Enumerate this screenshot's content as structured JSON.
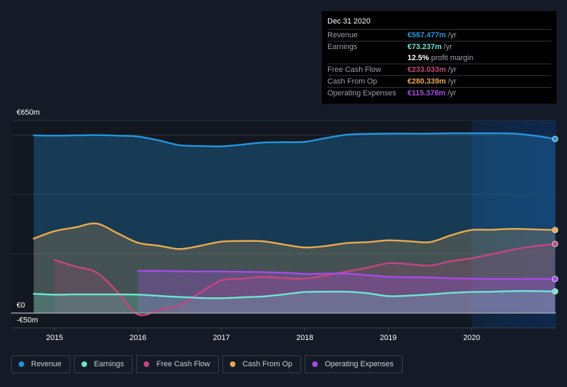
{
  "tooltip": {
    "date": "Dec 31 2020",
    "rows": [
      {
        "label": "Revenue",
        "value": "€587.477m",
        "unit": "/yr",
        "color": "#2394df"
      },
      {
        "label": "Earnings",
        "value": "€73.237m",
        "unit": "/yr",
        "color": "#6ce5d0"
      },
      {
        "label": "",
        "value": "12.5%",
        "unit": "profit margin",
        "color": "#ffffff"
      },
      {
        "label": "Free Cash Flow",
        "value": "€233.033m",
        "unit": "/yr",
        "color": "#c4467f"
      },
      {
        "label": "Cash From Op",
        "value": "€280.339m",
        "unit": "/yr",
        "color": "#e8a94e"
      },
      {
        "label": "Operating Expenses",
        "value": "€115.378m",
        "unit": "/yr",
        "color": "#a64ae8"
      }
    ]
  },
  "legend": [
    {
      "label": "Revenue",
      "color": "#2394df"
    },
    {
      "label": "Earnings",
      "color": "#6ce5d0"
    },
    {
      "label": "Free Cash Flow",
      "color": "#c4467f"
    },
    {
      "label": "Cash From Op",
      "color": "#e8a94e"
    },
    {
      "label": "Operating Expenses",
      "color": "#a64ae8"
    }
  ],
  "chart_data": {
    "type": "area",
    "title": "",
    "xlabel": "",
    "ylabel": "",
    "currency": "€",
    "y_unit": "m",
    "ylim": [
      -50,
      650
    ],
    "y_tick_labels": [
      {
        "value": 650,
        "label": "€650m"
      },
      {
        "value": 0,
        "label": "€0"
      },
      {
        "value": -50,
        "label": "-€50m"
      }
    ],
    "gridlines": [
      650,
      600,
      400,
      200,
      0,
      -50
    ],
    "xlim": [
      2014.5,
      2021.0
    ],
    "x_ticks": [
      2015,
      2016,
      2017,
      2018,
      2019,
      2020
    ],
    "highlight_from": 2020.0,
    "legend_position": "bottom-left",
    "series": [
      {
        "name": "Revenue",
        "color": "#2394df",
        "x": [
          2014.75,
          2015.0,
          2015.25,
          2015.5,
          2015.75,
          2016.0,
          2016.25,
          2016.5,
          2016.75,
          2017.0,
          2017.25,
          2017.5,
          2017.75,
          2018.0,
          2018.25,
          2018.5,
          2018.75,
          2019.0,
          2019.25,
          2019.5,
          2019.75,
          2020.0,
          2020.25,
          2020.5,
          2020.75,
          2021.0
        ],
        "values": [
          599,
          598,
          599,
          600,
          598,
          595,
          582,
          566,
          563,
          562,
          568,
          575,
          576,
          577,
          590,
          601,
          604,
          605,
          605,
          605,
          606,
          606,
          606,
          605,
          598,
          587
        ]
      },
      {
        "name": "Cash From Op",
        "color": "#e8a94e",
        "x": [
          2014.75,
          2015.0,
          2015.25,
          2015.5,
          2015.75,
          2016.0,
          2016.25,
          2016.5,
          2016.75,
          2017.0,
          2017.25,
          2017.5,
          2017.75,
          2018.0,
          2018.25,
          2018.5,
          2018.75,
          2019.0,
          2019.25,
          2019.5,
          2019.75,
          2020.0,
          2020.25,
          2020.5,
          2020.75,
          2021.0
        ],
        "values": [
          251,
          276,
          289,
          302,
          270,
          237,
          227,
          216,
          227,
          241,
          243,
          242,
          231,
          221,
          226,
          236,
          239,
          245,
          242,
          239,
          262,
          280,
          281,
          284,
          282,
          280
        ]
      },
      {
        "name": "Free Cash Flow",
        "color": "#c4467f",
        "x": [
          2015.0,
          2015.25,
          2015.5,
          2015.75,
          2016.0,
          2016.25,
          2016.5,
          2016.75,
          2017.0,
          2017.25,
          2017.5,
          2017.75,
          2018.0,
          2018.25,
          2018.5,
          2018.75,
          2019.0,
          2019.25,
          2019.5,
          2019.75,
          2020.0,
          2020.25,
          2020.5,
          2020.75,
          2021.0
        ],
        "values": [
          179,
          157,
          137,
          72,
          -5,
          10,
          27,
          70,
          110,
          116,
          122,
          118,
          116,
          127,
          140,
          153,
          168,
          165,
          160,
          175,
          185,
          199,
          214,
          225,
          233
        ]
      },
      {
        "name": "Operating Expenses",
        "color": "#a64ae8",
        "x": [
          2016.0,
          2016.25,
          2016.5,
          2016.75,
          2017.0,
          2017.25,
          2017.5,
          2017.75,
          2018.0,
          2018.25,
          2018.5,
          2018.75,
          2019.0,
          2019.25,
          2019.5,
          2019.75,
          2020.0,
          2020.25,
          2020.5,
          2020.75,
          2021.0
        ],
        "values": [
          142,
          142,
          141,
          140,
          140,
          139,
          138,
          136,
          132,
          133,
          133,
          128,
          122,
          121,
          120,
          117,
          116,
          115,
          115,
          115,
          115
        ]
      },
      {
        "name": "Earnings",
        "color": "#6ce5d0",
        "x": [
          2014.75,
          2015.0,
          2015.25,
          2015.5,
          2015.75,
          2016.0,
          2016.25,
          2016.5,
          2016.75,
          2017.0,
          2017.25,
          2017.5,
          2017.75,
          2018.0,
          2018.25,
          2018.5,
          2018.75,
          2019.0,
          2019.25,
          2019.5,
          2019.75,
          2020.0,
          2020.25,
          2020.5,
          2020.75,
          2021.0
        ],
        "values": [
          65,
          62,
          63,
          63,
          63,
          62,
          58,
          54,
          51,
          50,
          53,
          56,
          63,
          71,
          72,
          72,
          67,
          57,
          59,
          63,
          68,
          71,
          72,
          74,
          74,
          73
        ]
      }
    ]
  }
}
